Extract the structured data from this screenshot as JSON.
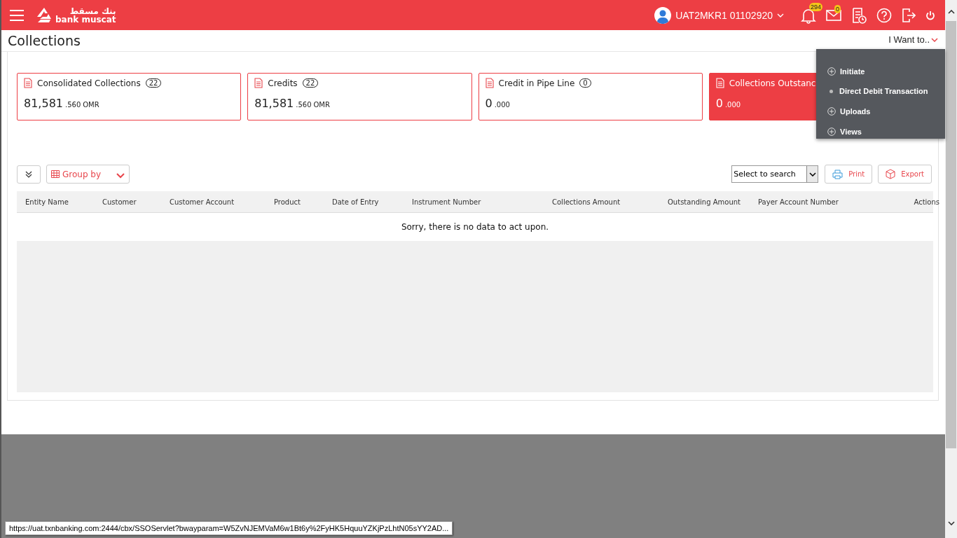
{
  "header": {
    "logo_arabic": "بنك مسقط",
    "logo_text": "bank muscat",
    "user": "UAT2MKR1 01102920",
    "notifications_count": "294",
    "messages_count": "0"
  },
  "page_title": "Collections",
  "i_want_to": {
    "label": "I Want to..",
    "expanded": true,
    "items": [
      {
        "kind": "group",
        "label": "Initiate"
      },
      {
        "kind": "item",
        "label": "Direct Debit Transaction"
      },
      {
        "kind": "group",
        "label": "Uploads"
      },
      {
        "kind": "group",
        "label": "Views"
      }
    ]
  },
  "cards": [
    {
      "title": "Consolidated Collections",
      "count": "22",
      "amount": "81,581",
      "decimals": ".560",
      "currency": "OMR",
      "selected": false
    },
    {
      "title": "Credits",
      "count": "22",
      "amount": "81,581",
      "decimals": ".560",
      "currency": "OMR",
      "selected": false
    },
    {
      "title": "Credit in Pipe Line",
      "count": "0",
      "amount": "0",
      "decimals": ".000",
      "selected": false
    },
    {
      "title": "Collections Outstanc",
      "amount": "0",
      "decimals": ".000",
      "selected": true
    }
  ],
  "toolbar": {
    "group_by": "Group by",
    "search_select": "Select to search",
    "print": "Print",
    "export": "Export"
  },
  "table": {
    "columns": [
      "Entity Name",
      "Customer",
      "Customer Account",
      "Product",
      "Date of Entry",
      "Instrument Number",
      "Collections Amount",
      "Outstanding Amount",
      "Payer Account Number",
      "Actions"
    ],
    "empty_message": "Sorry, there is no data to act upon."
  },
  "status_bar": {
    "url": "https://uat.txnbanking.com:2444/cbx/SSOServlet?bwayparam=W5ZvNJEMVaM6w1Bt6y%2FyHK5HquuYZKjPzLhtN05sYY2AD..."
  }
}
